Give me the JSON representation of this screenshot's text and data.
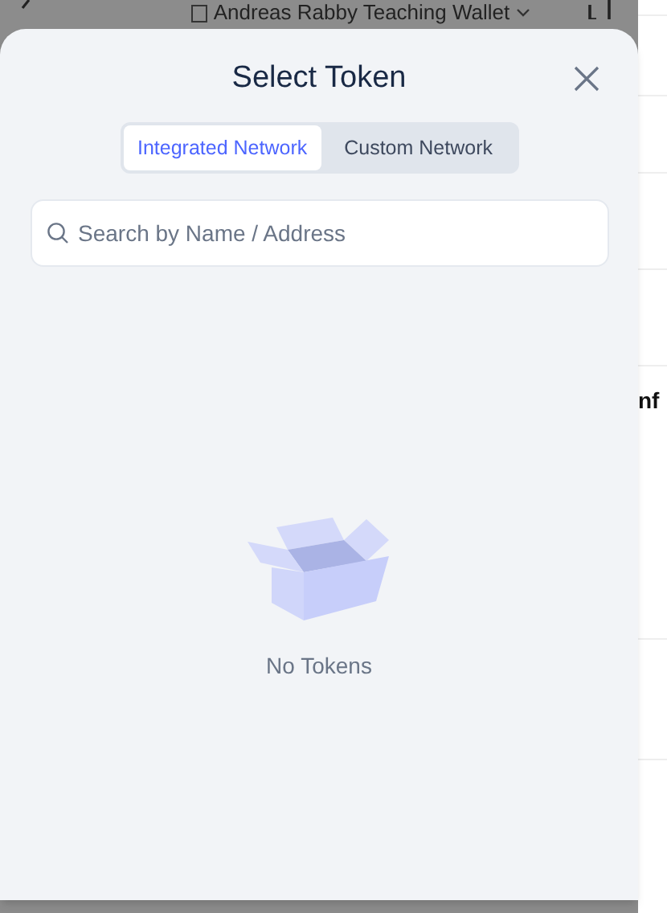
{
  "background": {
    "wallet_name": "Andreas Rabby Teaching Wallet",
    "side_text": "nf"
  },
  "drawer": {
    "title": "Select Token",
    "tabs": [
      {
        "label": "Integrated Network",
        "selected": true
      },
      {
        "label": "Custom Network",
        "selected": false
      }
    ],
    "search": {
      "placeholder": "Search by Name / Address"
    },
    "empty_text": "No Tokens"
  }
}
